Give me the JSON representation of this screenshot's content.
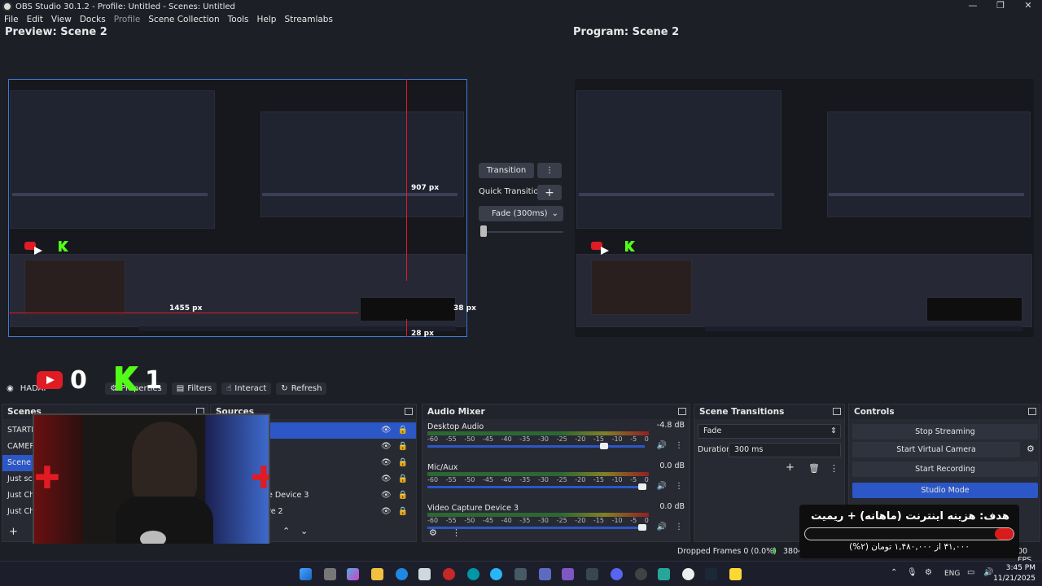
{
  "window": {
    "title": "OBS Studio 30.1.2 - Profile: Untitled - Scenes: Untitled",
    "min": "—",
    "max": "❐",
    "close": "✕"
  },
  "menu": [
    "File",
    "Edit",
    "View",
    "Docks",
    "Profile",
    "Scene Collection",
    "Tools",
    "Help",
    "Streamlabs"
  ],
  "preview": {
    "label": "Preview: Scene 2",
    "guide_top": "907 px",
    "guide_left": "1455 px",
    "guide_right": "38 px",
    "guide_bottom": "28 px"
  },
  "program": {
    "label": "Program: Scene 2"
  },
  "transition_panel": {
    "transition_label": "Transition",
    "quick_label": "Quick Transitions",
    "fade_label": "Fade (300ms)"
  },
  "overlay": {
    "youtube_count": "0",
    "kick_count": "1"
  },
  "source_toolbar": {
    "source_name": "HADAF",
    "properties": "Properties",
    "filters": "Filters",
    "interact": "Interact",
    "refresh": "Refresh"
  },
  "scenes": {
    "title": "Scenes",
    "items": [
      "STARTIN",
      "CAMERA",
      "Scene 2",
      "Just scre",
      "Just Cha",
      "Just Cha"
    ]
  },
  "sources": {
    "title": "Sources",
    "items": [
      "",
      "",
      "",
      "",
      "e Device 3",
      "re 2"
    ]
  },
  "mixer": {
    "title": "Audio Mixer",
    "scale": [
      "-60",
      "-55",
      "-50",
      "-45",
      "-40",
      "-35",
      "-30",
      "-25",
      "-20",
      "-15",
      "-10",
      "-5",
      "0"
    ],
    "channels": [
      {
        "name": "Desktop Audio",
        "db": "-4.8 dB",
        "volume": 0.82
      },
      {
        "name": "Mic/Aux",
        "db": "0.0 dB",
        "volume": 1.0
      },
      {
        "name": "Video Capture Device 3",
        "db": "0.0 dB",
        "volume": 1.0
      }
    ]
  },
  "scene_transitions": {
    "title": "Scene Transitions",
    "type": "Fade",
    "duration_label": "Duration",
    "duration_value": "300 ms"
  },
  "controls": {
    "title": "Controls",
    "stop_streaming": "Stop Streaming",
    "start_virtual_camera": "Start Virtual Camera",
    "start_recording": "Start Recording",
    "studio_mode": "Studio Mode"
  },
  "status": {
    "dropped_frames": "Dropped Frames 0 (0.0%)",
    "bitrate": "3804",
    "fps": "00 FPS"
  },
  "goal": {
    "title": "هدف: هزینه اینترنت (ماهانه) + ریمیت",
    "progress_label": "۳۱,۰۰۰ از ۱,۴۸۰,۰۰۰ تومان (۲%)",
    "progress": 0.02
  },
  "taskbar": {
    "lang": "ENG",
    "time": "3:45 PM",
    "date": "11/21/2025"
  }
}
